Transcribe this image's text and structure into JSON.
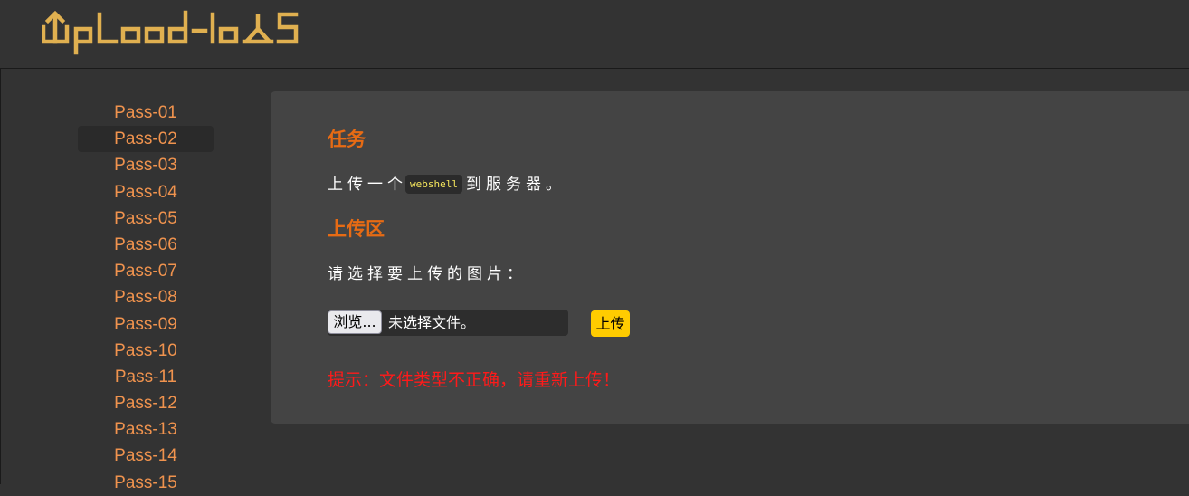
{
  "header": {
    "logo_text": "Upload-labs",
    "logo_color": "#e0b050"
  },
  "sidebar": {
    "accent_color": "#f0934e",
    "items": [
      {
        "label": "Pass-01"
      },
      {
        "label": "Pass-02"
      },
      {
        "label": "Pass-03"
      },
      {
        "label": "Pass-04"
      },
      {
        "label": "Pass-05"
      },
      {
        "label": "Pass-06"
      },
      {
        "label": "Pass-07"
      },
      {
        "label": "Pass-08"
      },
      {
        "label": "Pass-09"
      },
      {
        "label": "Pass-10"
      },
      {
        "label": "Pass-11"
      },
      {
        "label": "Pass-12"
      },
      {
        "label": "Pass-13"
      },
      {
        "label": "Pass-14"
      },
      {
        "label": "Pass-15"
      }
    ],
    "active": "Pass-02"
  },
  "task": {
    "heading": "任务",
    "text_before": "上传一个",
    "code": "webshell",
    "text_after": "到服务器。"
  },
  "upload": {
    "heading": "上传区",
    "prompt": "请选择要上传的图片：",
    "browse_label": "浏览...",
    "file_status": "未选择文件。",
    "submit_label": "上传",
    "hint": "提示：文件类型不正确，请重新上传！"
  }
}
